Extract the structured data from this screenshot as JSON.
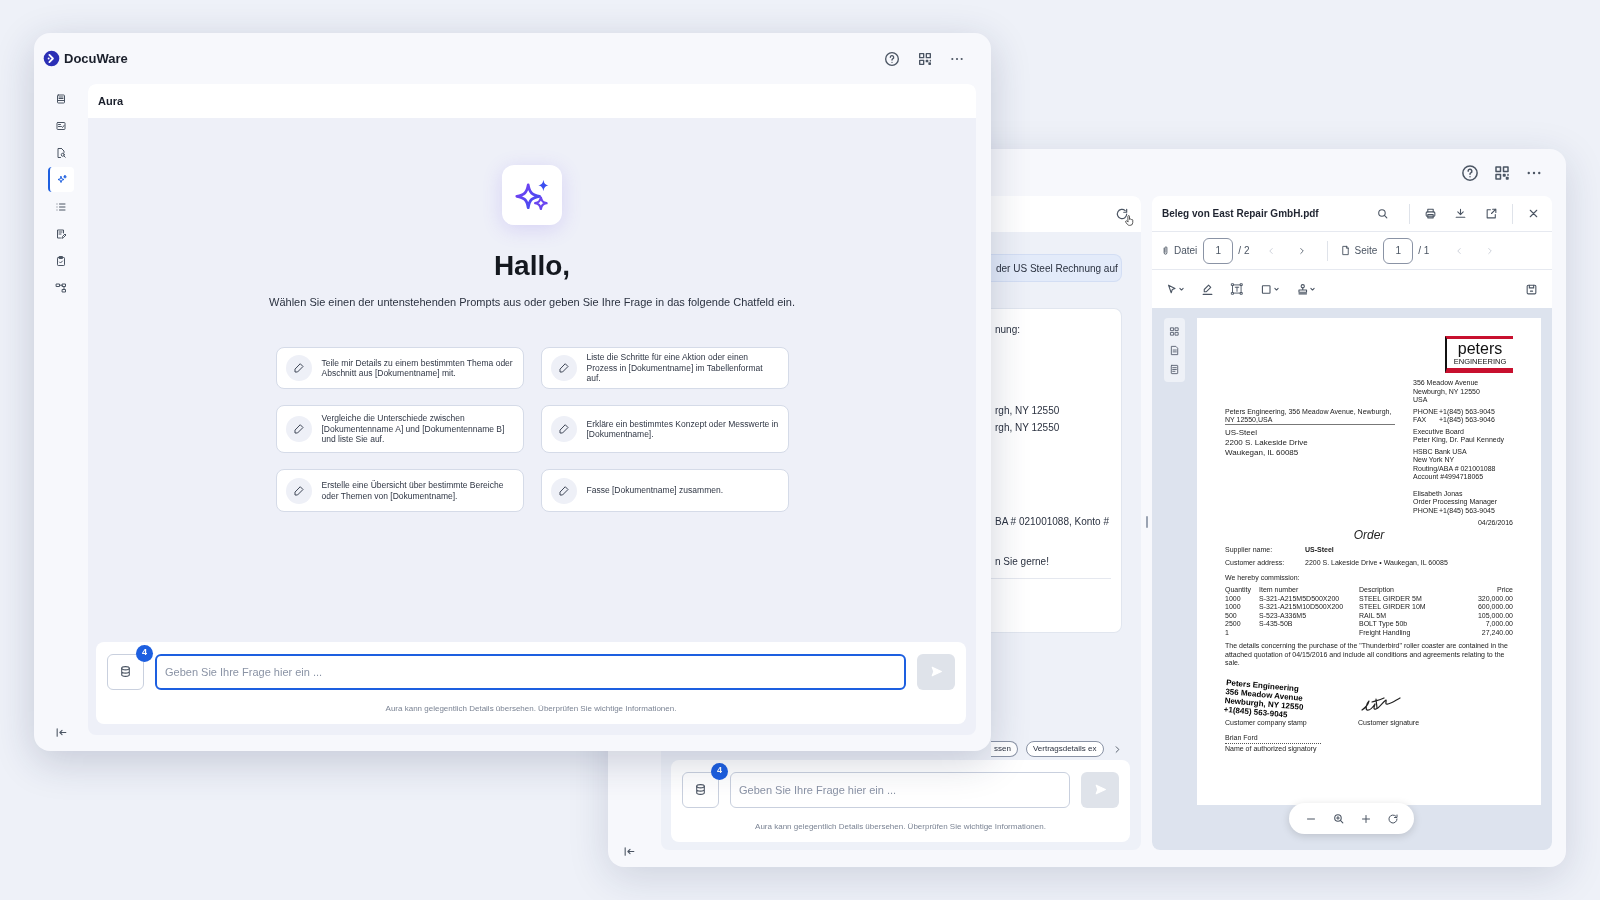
{
  "front_window": {
    "logo_text": "DocuWare",
    "sidebar": [
      {
        "selected": false
      },
      {
        "selected": false
      },
      {
        "selected": false
      },
      {
        "selected": true
      },
      {
        "selected": false
      },
      {
        "selected": false
      },
      {
        "selected": false
      },
      {
        "selected": false
      }
    ],
    "panel_title": "Aura",
    "greeting": "Hallo,",
    "intro": "Wählen Sie einen der untenstehenden Prompts aus oder geben Sie Ihre Frage in das folgende Chatfeld ein.",
    "prompts": [
      "Teile mir Details zu einem bestimmten Thema oder Abschnitt aus [Dokumentname] mit.",
      "Liste die Schritte für eine Aktion oder einen Prozess in [Dokumentname] im Tabellenformat auf.",
      "Vergleiche die Unterschiede zwischen [Dokumentenname A] und [Dokumentenname B] und liste Sie auf.",
      "Erkläre ein bestimmtes Konzept oder Messwerte in [Dokumentname].",
      "Erstelle eine Übersicht über bestimmte Bereiche oder Themen von [Dokumentname].",
      "Fasse [Dokumentname] zusammen."
    ],
    "composer": {
      "badge": "4",
      "placeholder": "Geben Sie Ihre Frage hier ein ...",
      "focused": true,
      "send_disabled": true,
      "disclaimer": "Aura kann gelegentlich Details übersehen. Überprüfen Sie wichtige Informationen."
    }
  },
  "back_window": {
    "chat": {
      "user_message": "der US Steel Rechnung auf",
      "answer_lines": [
        "nung:",
        "rgh, NY 12550",
        "rgh, NY 12550",
        "BA # 021001088, Konto #",
        "n Sie gerne!"
      ],
      "chips": [
        "ssen",
        "Vertragsdetails ex"
      ],
      "composer": {
        "badge": "4",
        "placeholder": "Geben Sie Ihre Frage hier ein ...",
        "focused": false,
        "send_disabled": true,
        "disclaimer": "Aura kann gelegentlich Details übersehen. Überprüfen Sie wichtige Informationen."
      }
    },
    "viewer": {
      "title": "Beleg von East Repair GmbH.pdf",
      "file_label": "Datei",
      "file_value": "1",
      "file_total": "/ 2",
      "file_prev_disabled": true,
      "file_next_disabled": false,
      "page_label": "Seite",
      "page_value": "1",
      "page_total": "/ 1",
      "page_prev_disabled": true,
      "page_next_disabled": true,
      "document": {
        "logo_top": "peters",
        "logo_bottom": "ENGINEERING",
        "sender_line": "Peters Engineering, 356 Meadow Avenue, Newburgh, NY 12550,USA",
        "recipient": [
          "US-Steel",
          "2200 S. Lakeside Drive",
          "Waukegan, IL 60085"
        ],
        "company_info": [
          [
            [
              "356 Meadow Avenue"
            ],
            [
              "Newburgh, NY 12550"
            ],
            [
              "USA"
            ]
          ],
          [
            [
              "PHONE",
              "+1(845) 563-9045"
            ],
            [
              "FAX",
              "+1(845) 563-9046"
            ]
          ],
          [
            [
              "Executive Board"
            ],
            [
              "Peter King, Dr. Paul Kennedy"
            ]
          ],
          [
            [
              "HSBC Bank USA"
            ],
            [
              "New York NY"
            ],
            [
              "Routing/ABA # 021001088"
            ],
            [
              "Account #4994718065"
            ]
          ]
        ],
        "contact": [
          [
            "Elisabeth Jonas"
          ],
          [
            "Order Processing Manager"
          ],
          [
            "PHONE",
            "+1(845) 563-9045"
          ]
        ],
        "date": "04/26/2016",
        "heading": "Order",
        "fields": [
          {
            "label": "Supplier name:",
            "value": "US-Steel",
            "bold": true
          },
          {
            "label": "Customer address:",
            "value": "2200 S. Lakeside Drive • Waukegan, IL 60085",
            "bold": false
          }
        ],
        "commission": "We hereby commission:",
        "table": {
          "columns": [
            "Quantity",
            "Item number",
            "Description",
            "Price"
          ],
          "rows": [
            {
              "quantity": "1000",
              "item_number": "S-321-A215M5D500X200",
              "description": "STEEL GIRDER 5M",
              "price": "320,000.00"
            },
            {
              "quantity": "1000",
              "item_number": "S-321-A215M10D500X200",
              "description": "STEEL GIRDER 10M",
              "price": "600,000.00"
            },
            {
              "quantity": "500",
              "item_number": "S-523-A336M5",
              "description": "RAIL 5M",
              "price": "105,000.00"
            },
            {
              "quantity": "2500",
              "item_number": "S-435-50B",
              "description": "BOLT Type 50b",
              "price": "7,000.00"
            },
            {
              "quantity": "1",
              "description": "Freight Handling",
              "price": "27,240.00"
            }
          ]
        },
        "note": "The details concerning the purchase of the \"Thunderbird\" roller coaster are contained in the attached quotation of 04/15/2016 and include all conditions and agreements relating to the sale.",
        "stamp": [
          "Peters Engineering",
          "356 Meadow Avenue",
          "Newburgh, NY 12550",
          "+1(845) 563-9045"
        ],
        "stamp_label": "Customer company stamp",
        "signature_label": "Customer signature",
        "signatory_name": "Brian Ford",
        "signatory_label": "Name of authorized signatory"
      }
    }
  }
}
